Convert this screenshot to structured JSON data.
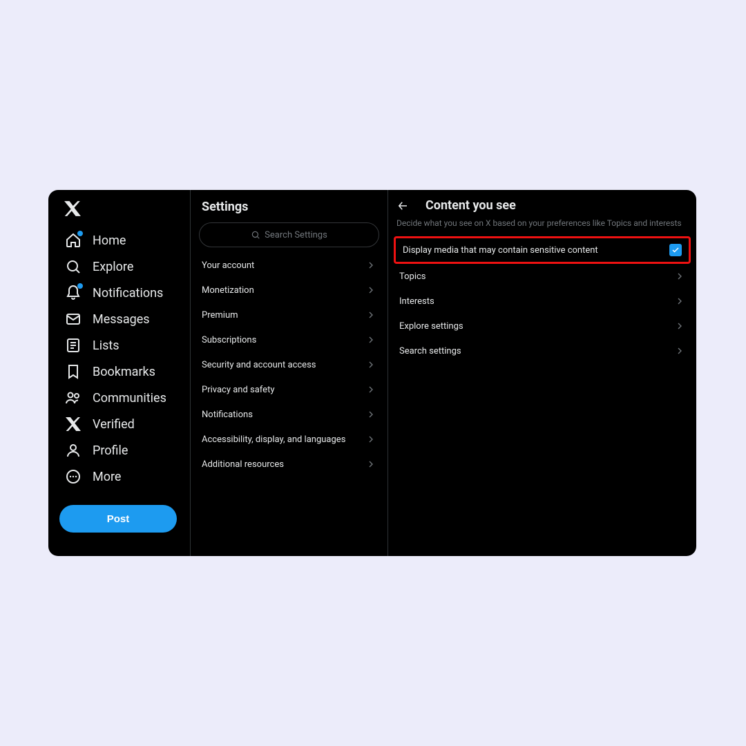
{
  "nav": {
    "items": [
      {
        "label": "Home",
        "icon": "home",
        "badge": true
      },
      {
        "label": "Explore",
        "icon": "search",
        "badge": false
      },
      {
        "label": "Notifications",
        "icon": "bell",
        "badge": true
      },
      {
        "label": "Messages",
        "icon": "mail",
        "badge": false
      },
      {
        "label": "Lists",
        "icon": "list",
        "badge": false
      },
      {
        "label": "Bookmarks",
        "icon": "bookmark",
        "badge": false
      },
      {
        "label": "Communities",
        "icon": "people",
        "badge": false
      },
      {
        "label": "Verified",
        "icon": "x",
        "badge": false
      },
      {
        "label": "Profile",
        "icon": "person",
        "badge": false
      },
      {
        "label": "More",
        "icon": "more",
        "badge": false
      }
    ],
    "post_label": "Post"
  },
  "settings": {
    "title": "Settings",
    "search_placeholder": "Search Settings",
    "rows": [
      "Your account",
      "Monetization",
      "Premium",
      "Subscriptions",
      "Security and account access",
      "Privacy and safety",
      "Notifications",
      "Accessibility, display, and languages",
      "Additional resources"
    ]
  },
  "content": {
    "title": "Content you see",
    "subtitle": "Decide what you see on X based on your preferences like Topics and interests",
    "sensitive_label": "Display media that may contain sensitive content",
    "sensitive_checked": true,
    "rows": [
      "Topics",
      "Interests",
      "Explore settings",
      "Search settings"
    ]
  }
}
